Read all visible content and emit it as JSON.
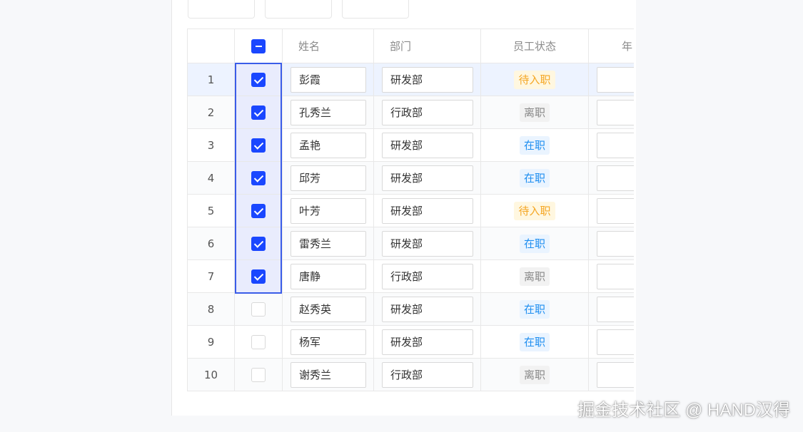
{
  "table": {
    "headers": {
      "name": "姓名",
      "dept": "部门",
      "status": "员工状态",
      "age": "年"
    },
    "header_checkbox_state": "indeterminate",
    "rows": [
      {
        "index": "1",
        "checked": true,
        "name": "彭霞",
        "dept": "研发部",
        "status": "待入职",
        "status_type": "pending"
      },
      {
        "index": "2",
        "checked": true,
        "name": "孔秀兰",
        "dept": "行政部",
        "status": "离职",
        "status_type": "left"
      },
      {
        "index": "3",
        "checked": true,
        "name": "孟艳",
        "dept": "研发部",
        "status": "在职",
        "status_type": "active"
      },
      {
        "index": "4",
        "checked": true,
        "name": "邱芳",
        "dept": "研发部",
        "status": "在职",
        "status_type": "active"
      },
      {
        "index": "5",
        "checked": true,
        "name": "叶芳",
        "dept": "研发部",
        "status": "待入职",
        "status_type": "pending"
      },
      {
        "index": "6",
        "checked": true,
        "name": "雷秀兰",
        "dept": "研发部",
        "status": "在职",
        "status_type": "active"
      },
      {
        "index": "7",
        "checked": true,
        "name": "唐静",
        "dept": "行政部",
        "status": "离职",
        "status_type": "left"
      },
      {
        "index": "8",
        "checked": false,
        "name": "赵秀英",
        "dept": "研发部",
        "status": "在职",
        "status_type": "active"
      },
      {
        "index": "9",
        "checked": false,
        "name": "杨军",
        "dept": "研发部",
        "status": "在职",
        "status_type": "active"
      },
      {
        "index": "10",
        "checked": false,
        "name": "谢秀兰",
        "dept": "行政部",
        "status": "离职",
        "status_type": "left"
      }
    ]
  },
  "colors": {
    "checkbox_accent": "#1a47ff",
    "status_pending": "#f5a623",
    "status_left": "#888888",
    "status_active": "#1e8ef0"
  },
  "watermark": "掘金技术社区 @ HAND汉得"
}
